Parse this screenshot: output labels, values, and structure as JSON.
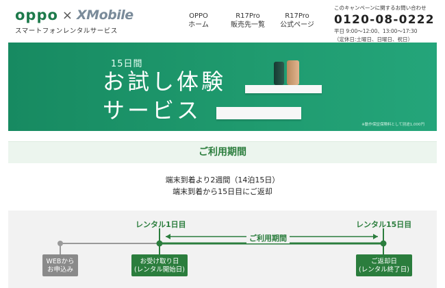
{
  "header": {
    "logo": {
      "brand": "oppo",
      "cross": "×",
      "partner": "XMobile",
      "tagline": "スマートフォンレンタルサービス"
    },
    "nav": [
      {
        "line1": "OPPO",
        "line2": "ホーム"
      },
      {
        "line1": "R17Pro",
        "line2": "販売先一覧"
      },
      {
        "line1": "R17Pro",
        "line2": "公式ページ"
      }
    ],
    "contact": {
      "label": "このキャンペーンに関するお問い合わせ",
      "phone": "0120-08-0222",
      "hours": "平日 9:00～12:00、13:00～17:30",
      "closed": "（定休日:土曜日、日曜日、祝日）"
    }
  },
  "hero": {
    "subtitle": "15日間",
    "title_line1": "お試し体験",
    "title_line2": "サービス",
    "note": "※動作保証保険料として別途1,000円"
  },
  "usage": {
    "title": "ご利用期間",
    "line1": "端末到着より2週間（14泊15日）",
    "line2": "端末到着から15日目にご返却"
  },
  "timeline": {
    "start_label": "レンタル1日目",
    "end_label": "レンタル15日目",
    "period_label": "ご利用期間",
    "web_box": {
      "line1": "WEBから",
      "line2": "お申込み"
    },
    "receive_box": {
      "line1": "お受け取り日",
      "line2": "(レンタル開始日)"
    },
    "return_box": {
      "line1": "ご返却日",
      "line2": "(レンタル終了日)"
    }
  },
  "colors": {
    "brand_green": "#2b7d3d",
    "hero_green": "#1f9a6e",
    "gray": "#8a8a8a"
  }
}
